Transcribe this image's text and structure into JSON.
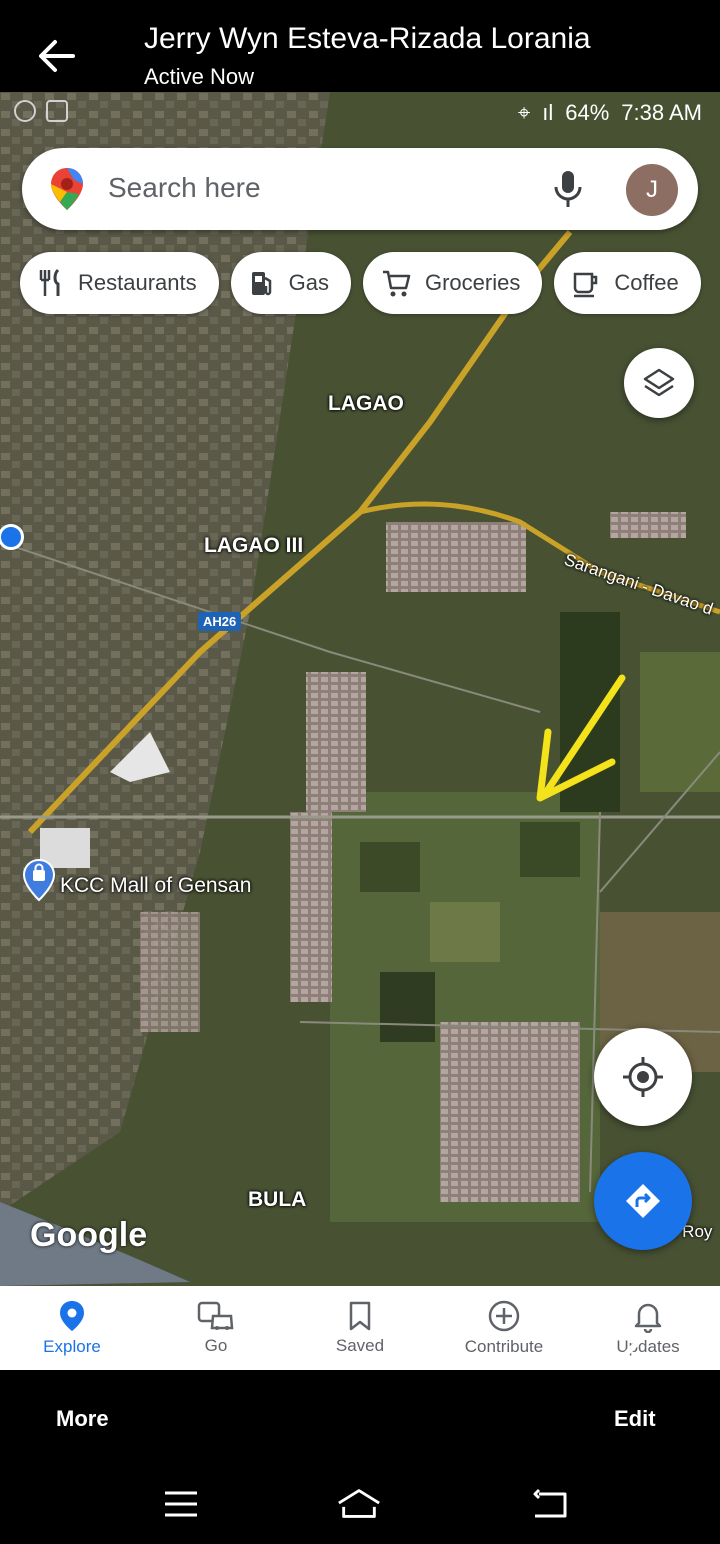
{
  "header": {
    "contact_name": "Jerry Wyn Esteva-Rizada Lorania",
    "status": "Active Now",
    "back_icon": "arrow-left-icon"
  },
  "status_bar": {
    "battery": "64%",
    "time": "7:38 AM"
  },
  "search": {
    "placeholder": "Search here",
    "avatar_letter": "J"
  },
  "chips": [
    {
      "label": "Restaurants",
      "icon": "fork-knife-icon"
    },
    {
      "label": "Gas",
      "icon": "gas-pump-icon"
    },
    {
      "label": "Groceries",
      "icon": "cart-icon"
    },
    {
      "label": "Coffee",
      "icon": "coffee-cup-icon"
    }
  ],
  "map_labels": {
    "lagao": "LAGAO",
    "lagao_iii": "LAGAO III",
    "ah26": "AH26",
    "road": "Sarangani - Davao d",
    "mall": "KCC Mall of Gensan",
    "bula": "BULA",
    "royal": "e Roy",
    "google": "Google"
  },
  "maps_nav": [
    {
      "label": "Explore",
      "icon": "location-pin-icon",
      "active": true
    },
    {
      "label": "Go",
      "icon": "commute-icon",
      "active": false
    },
    {
      "label": "Saved",
      "icon": "bookmark-icon",
      "active": false
    },
    {
      "label": "Contribute",
      "icon": "add-circle-icon",
      "active": false
    },
    {
      "label": "Updates",
      "icon": "bell-icon",
      "active": false
    }
  ],
  "messenger_bottom": {
    "more_label": "More",
    "edit_label": "Edit"
  },
  "colors": {
    "accent": "#1a73e8",
    "arrow_annotation": "#f4e21b",
    "road_yellow": "#c9a227"
  }
}
